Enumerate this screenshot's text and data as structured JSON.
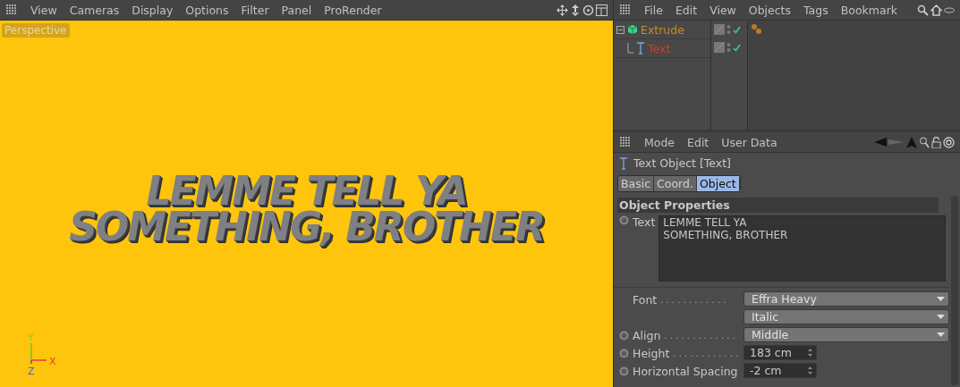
{
  "viewport": {
    "menu": [
      "View",
      "Cameras",
      "Display",
      "Options",
      "Filter",
      "Panel",
      "ProRender"
    ],
    "label": "Perspective",
    "scene_text": [
      "LEMME TELL YA",
      "SOMETHING, BROTHER"
    ],
    "axes": {
      "y": "Y",
      "x": "X",
      "z": "Z"
    }
  },
  "object_manager": {
    "menu": [
      "File",
      "Edit",
      "View",
      "Objects",
      "Tags",
      "Bookmark"
    ],
    "objects": [
      {
        "name": "Extrude",
        "kind": "extrude",
        "color": "#c98a2a",
        "enabled": true,
        "expanded": true,
        "children": [
          {
            "name": "Text",
            "kind": "text",
            "color": "#e0391f",
            "enabled": true
          }
        ]
      }
    ]
  },
  "attributes": {
    "menu": [
      "Mode",
      "Edit",
      "User Data"
    ],
    "title": "Text Object [Text]",
    "tabs": [
      {
        "label": "Basic",
        "selected": false
      },
      {
        "label": "Coord.",
        "selected": false
      },
      {
        "label": "Object",
        "selected": true
      }
    ],
    "section": "Object Properties",
    "text_field": {
      "label": "Text",
      "value": "LEMME TELL YA\nSOMETHING, BROTHER"
    },
    "fields": [
      {
        "label": "Font",
        "leader": ". . . . . . . . . . . .",
        "kind": "dropdown",
        "animatable": false,
        "values": [
          "Effra Heavy",
          "Italic"
        ]
      },
      {
        "label": "Align",
        "leader": ". . . . . . . . . . . . .",
        "kind": "dropdown",
        "animatable": true,
        "values": [
          "Middle"
        ]
      },
      {
        "label": "Height",
        "leader": ". . . . . . . . . . . .",
        "kind": "number",
        "animatable": true,
        "values": [
          "183 cm"
        ]
      },
      {
        "label": "Horizontal Spacing",
        "kind": "number",
        "animatable": true,
        "values": [
          "-2 cm"
        ]
      }
    ]
  }
}
